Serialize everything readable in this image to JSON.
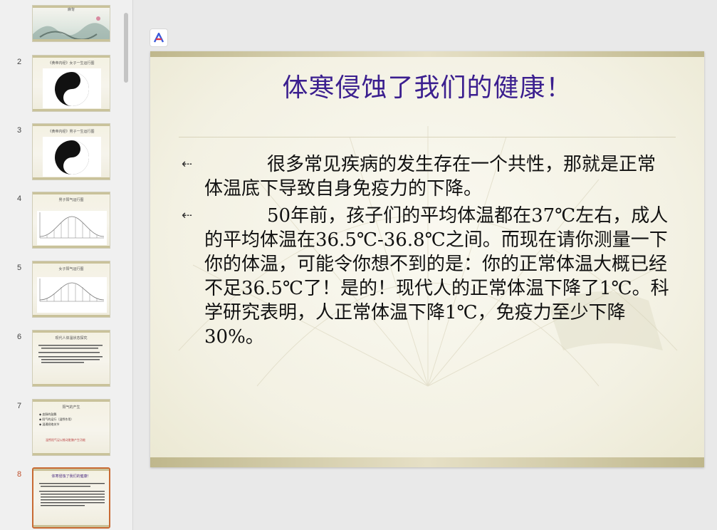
{
  "thumbnails": [
    {
      "num": "",
      "title": "麻背",
      "active": false
    },
    {
      "num": "2",
      "title": "《黄帝内经》女子一生运行图",
      "active": false
    },
    {
      "num": "3",
      "title": "《黄帝内经》男子一生运行图",
      "active": false
    },
    {
      "num": "4",
      "title": "男子阳气运行图",
      "active": false
    },
    {
      "num": "5",
      "title": "女子阳气运行图",
      "active": false
    },
    {
      "num": "6",
      "title": "现代人体温状态探究",
      "active": false
    },
    {
      "num": "7",
      "title": "阳气的产生",
      "active": false
    },
    {
      "num": "8",
      "title": "体寒侵蚀了我们的健康！",
      "active": true
    }
  ],
  "thumb7_lines": [
    "◆ 血脉的鼓舞",
    "◆ 阳气的运行（温煦作用）",
    "◆ 温通经络关节",
    "温煦阳气足以推动脏腑产生功能"
  ],
  "slide": {
    "title": "体寒侵蚀了我们的健康！",
    "bullets": [
      "很多常见疾病的发生存在一个共性，那就是正常体温底下导致自身免疫力的下降。",
      "50年前，孩子们的平均体温都在37℃左右，成人的平均体温在36.5℃-36.8℃之间。而现在请你测量一下你的体温，可能令你想不到的是：你的正常体温大概已经不足36.5℃了！是的！现代人的正常体温下降了1℃。科学研究表明，人正常体温下降1℃，免疫力至少下降30%。"
    ],
    "bullet_marker": "⇠"
  },
  "colors": {
    "title": "#3b1f8f",
    "active_border": "#c86a33"
  }
}
